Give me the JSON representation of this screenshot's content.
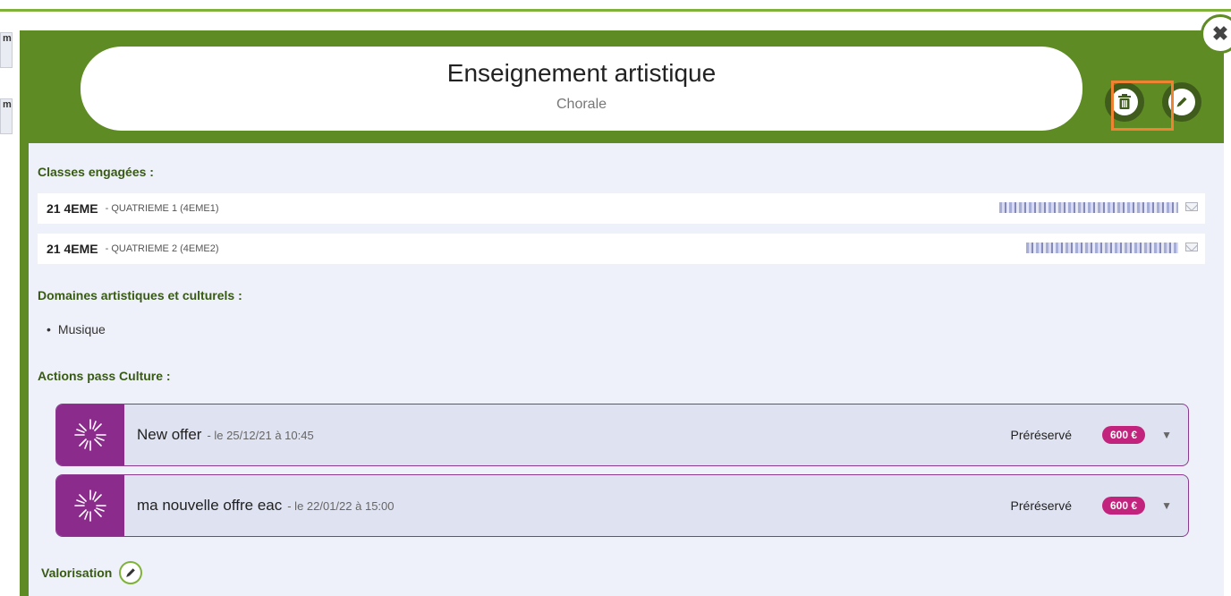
{
  "background": {
    "tab_letter_1": "m",
    "tab_letter_2": "m"
  },
  "header": {
    "title": "Enseignement artistique",
    "subtitle": "Chorale",
    "close_symbol": "✖"
  },
  "sections": {
    "classes_label": "Classes engagées :",
    "domains_label": "Domaines artistiques et culturels :",
    "actions_label": "Actions pass Culture :",
    "valorisation_label": "Valorisation"
  },
  "classes": [
    {
      "code": "21 4EME",
      "description": "- QUATRIEME 1 (4EME1)"
    },
    {
      "code": "21 4EME",
      "description": "- QUATRIEME 2 (4EME2)"
    }
  ],
  "domains": [
    "Musique"
  ],
  "actions": [
    {
      "name": "New offer",
      "date": "- le 25/12/21 à 10:45",
      "status": "Préréservé",
      "price": "600 €"
    },
    {
      "name": "ma nouvelle offre eac",
      "date": "- le 22/01/22 à 15:00",
      "status": "Préréservé",
      "price": "600 €"
    }
  ],
  "colors": {
    "header_green": "#5e8b23",
    "label_green": "#385a14",
    "highlight_orange": "#ee8433",
    "pass_purple": "#8b2b8c",
    "badge_magenta": "#c2237d"
  },
  "icons": [
    "trash-icon",
    "pencil-icon",
    "close-icon",
    "mail-icon",
    "pass-culture-burst-icon",
    "chevron-down-icon"
  ]
}
